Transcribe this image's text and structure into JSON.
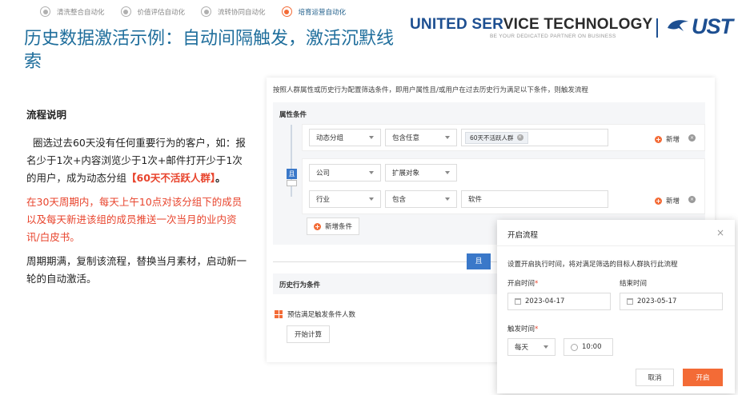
{
  "steps": [
    {
      "label": "清洗整合自动化",
      "active": false
    },
    {
      "label": "价值评估自动化",
      "active": false
    },
    {
      "label": "流转协同自动化",
      "active": false
    },
    {
      "label": "培育运营自动化",
      "active": true
    }
  ],
  "title": "历史数据激活示例：自动间隔触发，激活沉默线索",
  "brand": {
    "name_part1": "UNITED SER",
    "name_part2": "VICE TECHNOLOGY",
    "tagline": "BE YOUR DEDICATED PARTNER ON BUSINESS",
    "logo_text": "UST"
  },
  "explanation": {
    "heading": "流程说明",
    "p1_a": "圈选过去60天没有任何重要行为的客户，如：报名少于1次+内容浏览少于1次+邮件打开少于1次的用户，成为动态分组",
    "p1_highlight": "【60天不活跃人群】",
    "p1_end": "。",
    "p2": "在30天周期内，每天上午10点对该分组下的成员以及每天新进该组的成员推送一次当月的业内资讯/白皮书。",
    "p3": "周期期满，复制该流程，替换当月素材，启动新一轮的自动激活。"
  },
  "panel": {
    "description": "按照人群属性或历史行为配置筛选条件，即用户属性且/或用户在过去历史行为满足以下条件，则触发流程",
    "attr_title": "属性条件",
    "and_label": "且",
    "group1": {
      "field": "动态分组",
      "operator": "包含任意",
      "tag": "60天不活跃人群",
      "add_label": "新增"
    },
    "group2": {
      "row1_field": "公司",
      "row1_operator": "扩展对象",
      "row2_field": "行业",
      "row2_operator": "包含",
      "row2_value": "软件",
      "add_label": "新增"
    },
    "add_condition_label": "新增条件",
    "middle_and": "且",
    "history_title": "历史行为条件",
    "estimate_label": "预估满足触发条件人数",
    "calc_button": "开始计算"
  },
  "modal": {
    "title": "开启流程",
    "close": "×",
    "instruction": "设置开启执行时间，将对满足筛选的目标人群执行此流程",
    "start_label": "开启时间",
    "end_label": "结束时间",
    "start_date": "2023-04-17",
    "end_date": "2023-05-17",
    "trigger_label": "触发时间",
    "frequency": "每天",
    "time": "10:00",
    "cancel": "取消",
    "confirm": "开启"
  },
  "colors": {
    "accent_orange": "#f36b36",
    "title_blue": "#1f6e9c",
    "brand_blue": "#1d4f91",
    "highlight_red": "#e8442d"
  }
}
